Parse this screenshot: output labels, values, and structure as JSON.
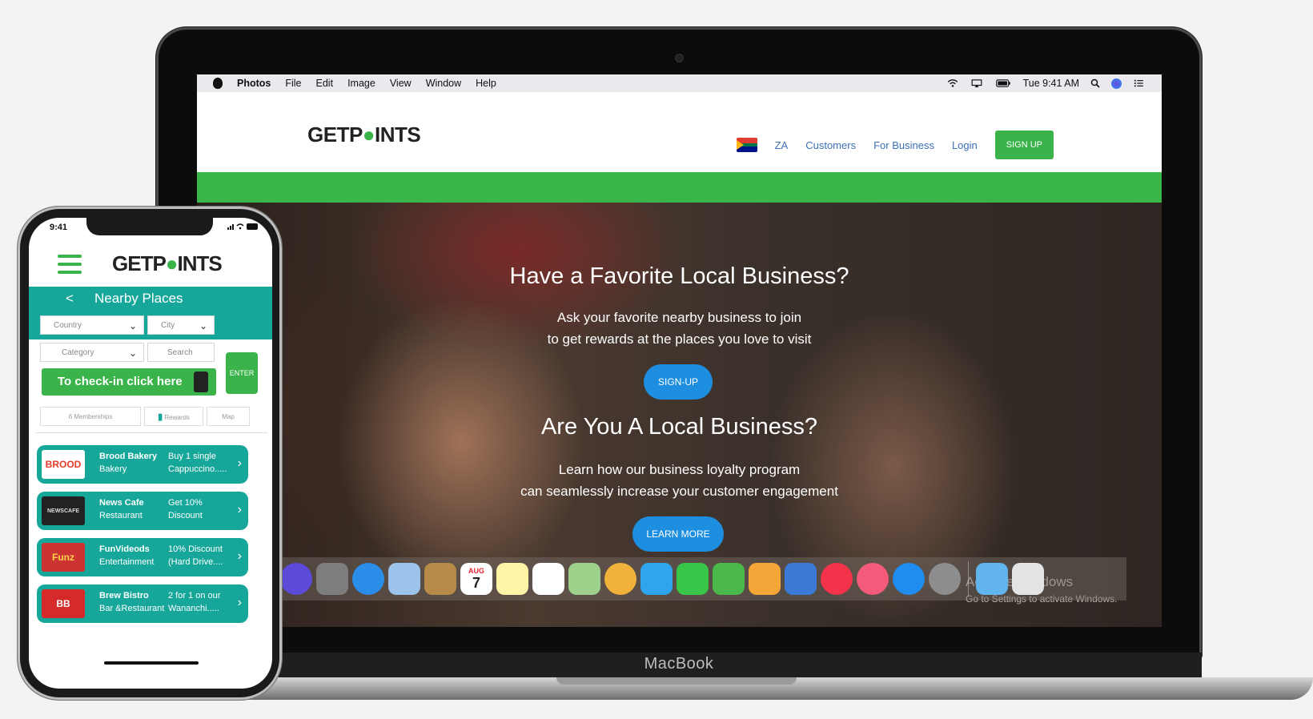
{
  "macbook": {
    "label": "MacBook",
    "menubar": {
      "app": "Photos",
      "items": [
        "File",
        "Edit",
        "Image",
        "View",
        "Window",
        "Help"
      ],
      "clock": "Tue 9:41 AM"
    },
    "site": {
      "logo_before": "GETP",
      "logo_pin": "●",
      "logo_after": "INTS",
      "nav": {
        "country": "ZA",
        "customers": "Customers",
        "for_business": "For Business",
        "login": "Login",
        "signup": "SIGN UP"
      },
      "hero": {
        "heading1": "Have a Favorite Local Business?",
        "text1_line1": "Ask your favorite nearby business to join",
        "text1_line2": "to get rewards at the places you love to visit",
        "button1": "SIGN-UP",
        "heading2": "Are You A Local Business?",
        "text2_line1": "Learn how our business loyalty program",
        "text2_line2": "can seamlessly increase your customer engagement",
        "button2": "LEARN MORE"
      },
      "watermark": {
        "line1": "Activate Windows",
        "line2": "Go to Settings to activate Windows."
      }
    },
    "dock": [
      {
        "icon": "siri-icon",
        "color": "#5b4bd8"
      },
      {
        "icon": "launchpad-icon",
        "color": "#7d7d7d"
      },
      {
        "icon": "safari-icon",
        "color": "#2a8de8"
      },
      {
        "icon": "mail-icon",
        "color": "#9cc3ea"
      },
      {
        "icon": "contacts-icon",
        "color": "#b88a4a"
      },
      {
        "icon": "calendar-icon",
        "color": "#ffffff"
      },
      {
        "icon": "notes-icon",
        "color": "#fff3a6"
      },
      {
        "icon": "reminders-icon",
        "color": "#ffffff"
      },
      {
        "icon": "maps-icon",
        "color": "#9ed18c"
      },
      {
        "icon": "photos-icon",
        "color": "#f0b23a"
      },
      {
        "icon": "messages-icon",
        "color": "#2fa5f0"
      },
      {
        "icon": "facetime-icon",
        "color": "#38c548"
      },
      {
        "icon": "numbers-icon",
        "color": "#4bb84b"
      },
      {
        "icon": "pages-icon",
        "color": "#f4a738"
      },
      {
        "icon": "keynote-icon",
        "color": "#3a7ad6"
      },
      {
        "icon": "news-icon",
        "color": "#f2334a"
      },
      {
        "icon": "music-icon",
        "color": "#f45a7a"
      },
      {
        "icon": "app-store-icon",
        "color": "#1f8cf0"
      },
      {
        "icon": "system-preferences-icon",
        "color": "#8d8d8d"
      },
      {
        "icon": "downloads-folder-icon",
        "color": "#62b4ef"
      },
      {
        "icon": "trash-icon",
        "color": "#e4e4e4"
      }
    ],
    "dock_calendar_month": "AUG",
    "dock_calendar_day": "7"
  },
  "phone": {
    "time": "9:41",
    "logo_before": "GETP",
    "logo_pin": "●",
    "logo_after": "INTS",
    "page_title": "Nearby Places",
    "back": "<",
    "filters": {
      "country": "Country",
      "city": "City",
      "category": "Category",
      "search": "Search"
    },
    "enter": "ENTER",
    "checkin": "To check-in click here",
    "tabs": {
      "memberships": "6 Memberships",
      "rewards": "Rewards",
      "map": "Map"
    },
    "places": [
      {
        "name": "Brood Bakery",
        "category": "Bakery",
        "offer_line1": "Buy 1 single",
        "offer_line2": "Cappuccino.....",
        "thumb": "BROOD"
      },
      {
        "name": "News Cafe",
        "category": "Restaurant",
        "offer_line1": "Get 10%",
        "offer_line2": "Discount",
        "thumb": "NEWSCAFE"
      },
      {
        "name": "FunVideods",
        "category": "Entertainment",
        "offer_line1": "10% Discount",
        "offer_line2": "(Hard Drive....",
        "thumb": "Funz"
      },
      {
        "name": "Brew Bistro",
        "category": "Bar &Restaurant",
        "offer_line1": "2 for 1 on our",
        "offer_line2": "Wananchi.....",
        "thumb": "BB"
      }
    ]
  }
}
